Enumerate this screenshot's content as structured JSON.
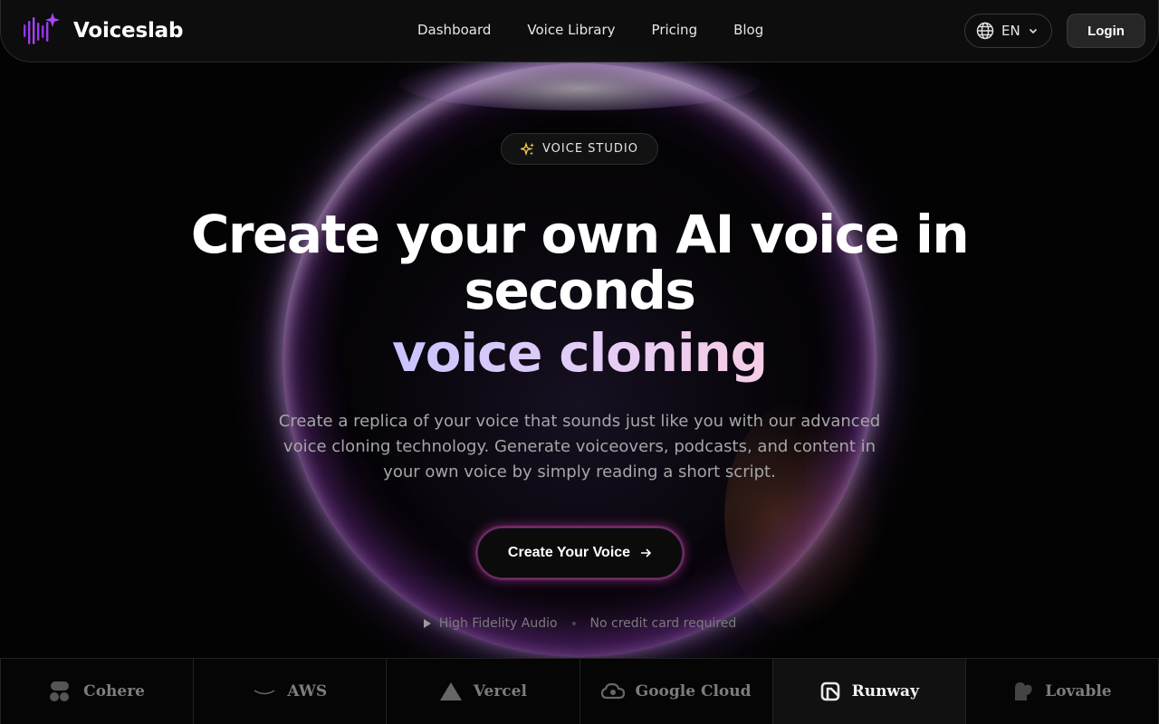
{
  "brand": {
    "name": "Voiceslab",
    "accent": "#9b3cf0"
  },
  "nav": {
    "links": [
      "Dashboard",
      "Voice Library",
      "Pricing",
      "Blog"
    ],
    "language": "EN",
    "login_label": "Login"
  },
  "hero": {
    "badge": "VOICE STUDIO",
    "title": "Create your own AI voice in seconds",
    "title_accent": "voice cloning",
    "subtitle": "Create a replica of your voice that sounds just like you with our advanced voice cloning technology. Generate voiceovers, podcasts, and content in your own voice by simply reading a short script.",
    "cta_label": "Create Your Voice",
    "meta": [
      "High Fidelity Audio",
      "No credit card required"
    ]
  },
  "partners": [
    {
      "name": "Cohere",
      "icon": "cohere-icon",
      "active": false
    },
    {
      "name": "AWS",
      "icon": "aws-icon",
      "active": false
    },
    {
      "name": "Vercel",
      "icon": "vercel-icon",
      "active": false
    },
    {
      "name": "Google Cloud",
      "icon": "google-cloud-icon",
      "active": false
    },
    {
      "name": "Runway",
      "icon": "runway-icon",
      "active": true
    },
    {
      "name": "Lovable",
      "icon": "lovable-icon",
      "active": false
    }
  ]
}
